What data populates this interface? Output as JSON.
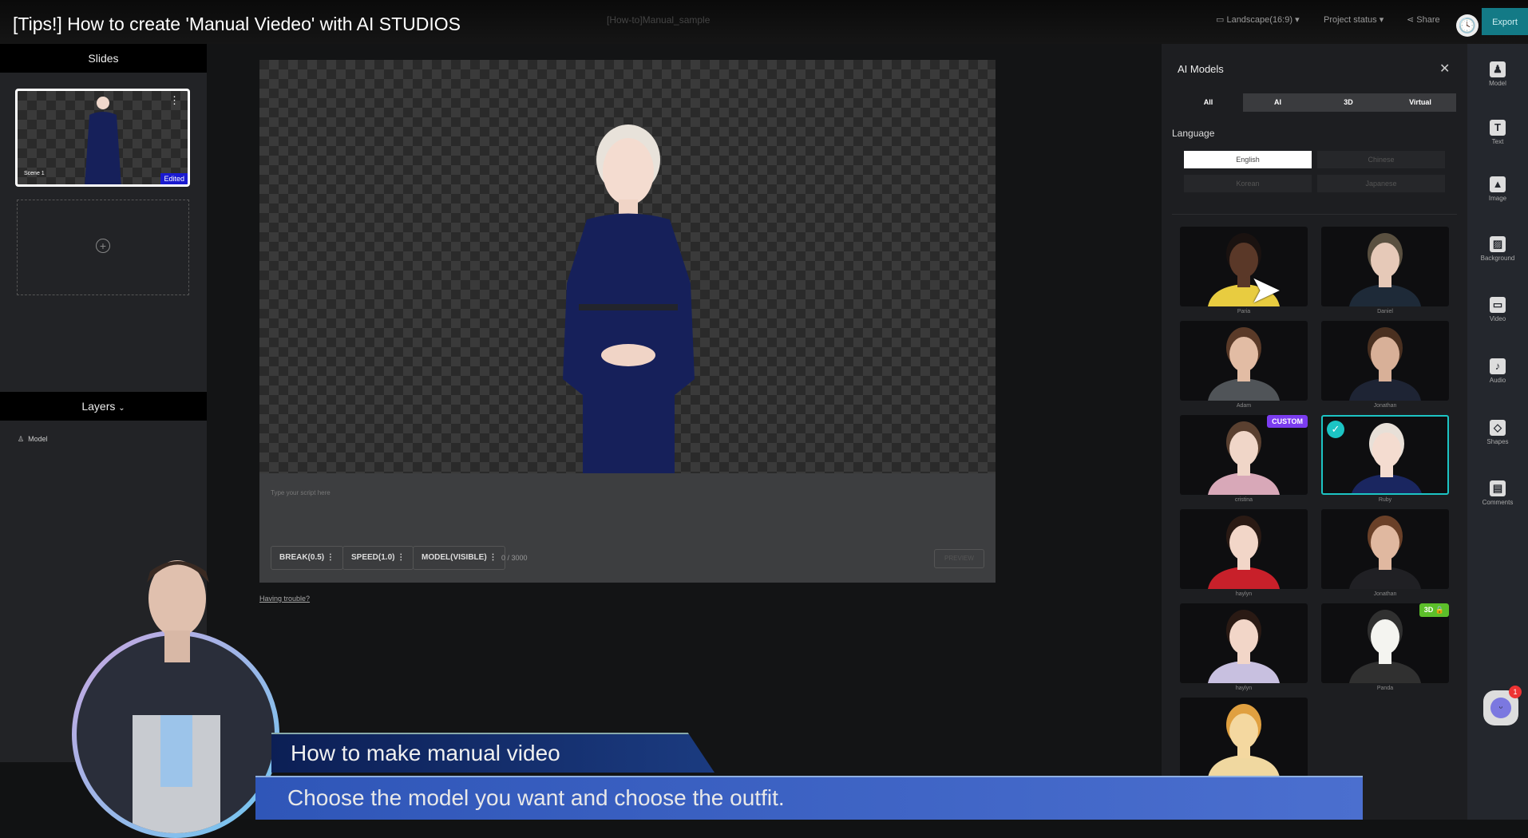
{
  "video_title": "[Tips!] How to create 'Manual Viedeo' with AI STUDIOS",
  "topbar": {
    "project_name": "[How-to]Manual_sample",
    "orientation": "Landscape(16:9)",
    "project_status": "Project status",
    "share": "Share",
    "export": "Export"
  },
  "slides": {
    "header": "Slides",
    "scene_label": "Scene 1",
    "edited_badge": "Edited"
  },
  "layers": {
    "header": "Layers",
    "items": [
      {
        "label": "Model"
      }
    ]
  },
  "script": {
    "placeholder": "Type your script here",
    "break": "BREAK(0.5)",
    "speed": "SPEED(1.0)",
    "model": "MODEL(VISIBLE)",
    "counter": "0 / 3000",
    "preview": "PREVIEW",
    "trouble": "Having trouble?"
  },
  "ai_models": {
    "title": "AI Models",
    "tabs": [
      "All",
      "AI",
      "3D",
      "Virtual"
    ],
    "language_label": "Language",
    "languages": [
      "English",
      "Chinese",
      "Korean",
      "Japanese"
    ],
    "selected_language": "English",
    "models": [
      {
        "name": "Paria",
        "skin": "#5a3828",
        "hair": "#1a1210",
        "cloth": "#e8cc40"
      },
      {
        "name": "Daniel",
        "skin": "#e6c9b8",
        "hair": "#5a5040",
        "cloth": "#1e2a38"
      },
      {
        "name": "Adam",
        "skin": "#e2bca4",
        "hair": "#5a3a28",
        "cloth": "#505458"
      },
      {
        "name": "Jonathan",
        "skin": "#d8b098",
        "hair": "#4a3020",
        "cloth": "#1e2434"
      },
      {
        "name": "cristina",
        "skin": "#f0d6c8",
        "hair": "#5a4030",
        "cloth": "#d8a8b8",
        "badge": "CUSTOM"
      },
      {
        "name": "Ruby",
        "skin": "#f4dcd0",
        "hair": "#e8e0d8",
        "cloth": "#1a2660",
        "selected": true
      },
      {
        "name": "haylyn",
        "skin": "#f2d6c8",
        "hair": "#2a1a14",
        "cloth": "#c8202a"
      },
      {
        "name": "Jonathan",
        "skin": "#e0b8a0",
        "hair": "#6a4028",
        "cloth": "#202024"
      },
      {
        "name": "haylyn",
        "skin": "#f2d6c8",
        "hair": "#2a1a14",
        "cloth": "#c8c0e0"
      },
      {
        "name": "Panda",
        "skin": "#f4f4f0",
        "hair": "#303030",
        "cloth": "#303030",
        "badge": "3D"
      },
      {
        "name": "",
        "skin": "#f4d8a0",
        "hair": "#e0a040",
        "cloth": "#f0d8a0"
      }
    ]
  },
  "toolbar": [
    {
      "label": "Model",
      "glyph": "♟"
    },
    {
      "label": "Text",
      "glyph": "T"
    },
    {
      "label": "Image",
      "glyph": "▲"
    },
    {
      "label": "Background",
      "glyph": "▨"
    },
    {
      "label": "Video",
      "glyph": "▭"
    },
    {
      "label": "Audio",
      "glyph": "♪"
    },
    {
      "label": "Shapes",
      "glyph": "◇"
    },
    {
      "label": "Comments",
      "glyph": "▤"
    }
  ],
  "chatbot_badge": "1",
  "overlay": {
    "title": "How to make manual video",
    "subtitle": "Choose the model you want and choose the outfit."
  },
  "colors": {
    "accent": "#1cc4c4",
    "custom": "#7b3cf0",
    "badge3d": "#5cbf2a",
    "edited": "#1a1ad0"
  }
}
